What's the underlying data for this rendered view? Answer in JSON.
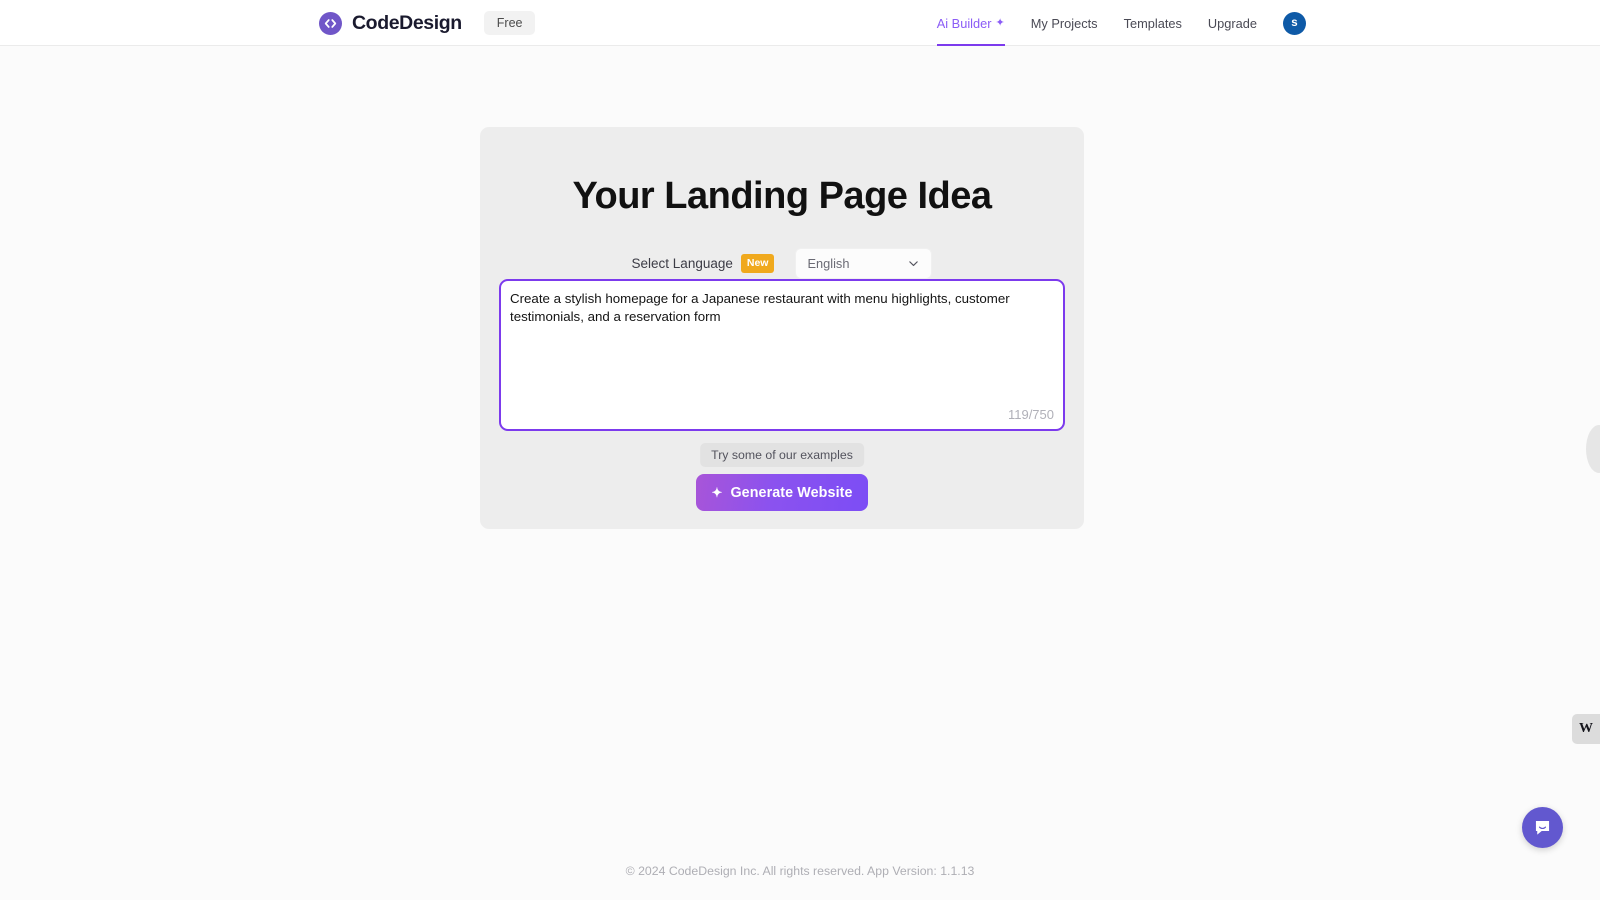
{
  "header": {
    "brand_name": "CodeDesign",
    "logo_icon": "code-brackets-icon",
    "plan_badge": "Free",
    "nav_items": [
      {
        "label": "Ai Builder",
        "icon": "sparkle-icon",
        "active": true
      },
      {
        "label": "My Projects",
        "active": false
      },
      {
        "label": "Templates",
        "active": false
      },
      {
        "label": "Upgrade",
        "active": false
      }
    ],
    "avatar_initial": "s",
    "avatar_color": "#0e5aa7",
    "accent_color": "#7c3aed"
  },
  "card": {
    "title": "Your Landing Page Idea",
    "language": {
      "label": "Select Language",
      "badge": "New",
      "badge_color": "#f0a91d",
      "selected": "English",
      "chevron_icon": "chevron-down-icon",
      "options": [
        "English"
      ]
    },
    "prompt": {
      "value": "Create a stylish homepage for a Japanese restaurant with menu highlights, customer testimonials, and a reservation form",
      "placeholder": "Describe your website idea...",
      "char_count": "119/750",
      "count_current": 119,
      "count_max": 750,
      "border_color": "#7c3aed"
    },
    "examples_label": "Try some of our examples",
    "generate": {
      "label": "Generate Website",
      "icon": "sparkle-icon",
      "gradient_from": "#a855d8",
      "gradient_to": "#7c4df5"
    }
  },
  "footer": {
    "text": "© 2024 CodeDesign Inc. All rights reserved. App Version: 1.1.13"
  },
  "widgets": {
    "side_tab_label": "W",
    "chat_icon": "chat-bubble-icon",
    "chat_color": "#6258cf"
  }
}
